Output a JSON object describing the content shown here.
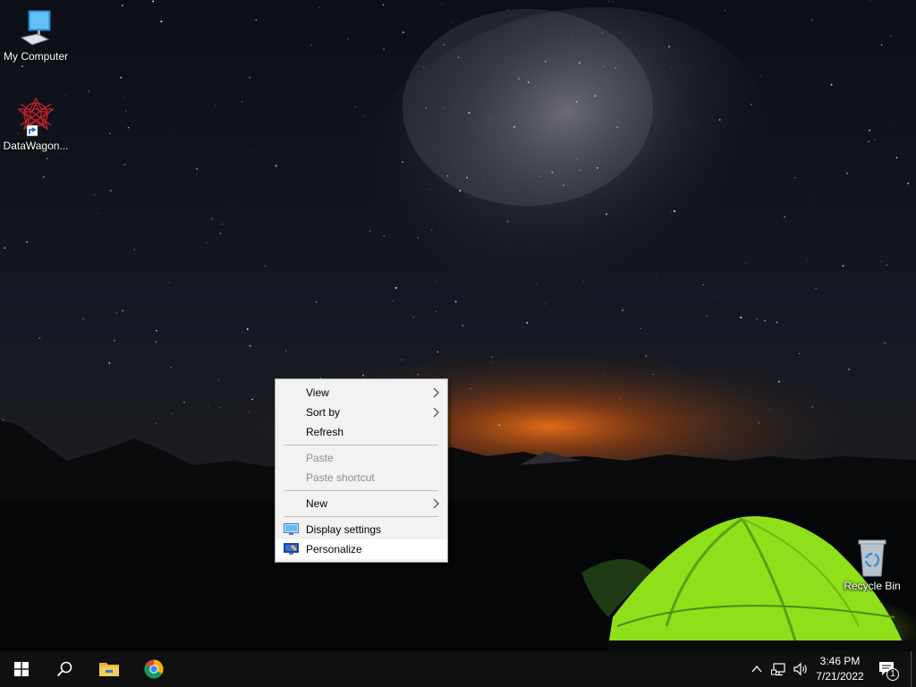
{
  "desktop_icons": {
    "my_computer": {
      "label": "My Computer",
      "icon": "computer-icon"
    },
    "datawagon": {
      "label": "DataWagon...",
      "icon": "datawagon-shortcut-icon"
    },
    "recycle_bin": {
      "label": "Recycle Bin",
      "icon": "recycle-bin-icon"
    }
  },
  "context_menu": {
    "items": [
      {
        "label": "View",
        "submenu": true,
        "enabled": true
      },
      {
        "label": "Sort by",
        "submenu": true,
        "enabled": true
      },
      {
        "label": "Refresh",
        "submenu": false,
        "enabled": true
      },
      {
        "label": "Paste",
        "submenu": false,
        "enabled": false
      },
      {
        "label": "Paste shortcut",
        "submenu": false,
        "enabled": false
      },
      {
        "label": "New",
        "submenu": true,
        "enabled": true
      },
      {
        "label": "Display settings",
        "submenu": false,
        "enabled": true,
        "icon": "display-settings-icon"
      },
      {
        "label": "Personalize",
        "submenu": false,
        "enabled": true,
        "icon": "personalize-icon",
        "highlighted": true
      }
    ]
  },
  "taskbar": {
    "start": {
      "icon": "windows-start-icon"
    },
    "search": {
      "icon": "search-icon"
    },
    "pinned": [
      {
        "icon": "file-explorer-icon"
      },
      {
        "icon": "chrome-icon"
      }
    ],
    "tray": {
      "chevron": "chevron-up-icon",
      "network": "network-icon",
      "volume": "volume-icon"
    },
    "clock": {
      "time": "3:46 PM",
      "date": "7/21/2022"
    },
    "notifications": {
      "icon": "notification-icon",
      "count": "1"
    }
  },
  "colors": {
    "taskbar": "#101010",
    "menu_bg": "#f2f2f2",
    "menu_highlight": "#ffffff",
    "menu_disabled_text": "#8d8d8d",
    "tent_green": "#8fe01a"
  }
}
